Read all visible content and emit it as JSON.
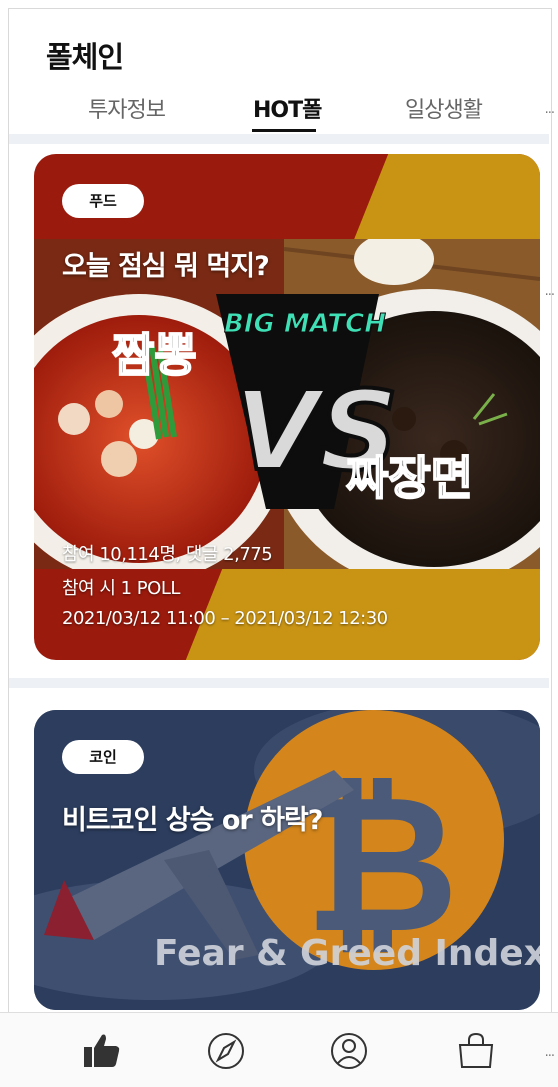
{
  "app": {
    "title": "폴체인"
  },
  "tabs": [
    {
      "label": "투자정보"
    },
    {
      "label": "HOT폴"
    },
    {
      "label": "일상생활"
    }
  ],
  "active_tab": "HOT폴",
  "more_label": "...",
  "polls": [
    {
      "category": "푸드",
      "title": "오늘 점심 뭐 먹지?",
      "image_text": {
        "left": "짬뽕",
        "right": "짜장면",
        "vs": "VS",
        "banner": "BIG MATCH"
      },
      "stats": "참여 10,114명, 댓글 2,775",
      "reward": "참여 시 1 POLL",
      "period": "2021/03/12 11:00 – 2021/03/12 12:30"
    },
    {
      "category": "코인",
      "title": "비트코인 상승 or 하락?",
      "image_text": {
        "overlay": "Fear & Greed Index"
      }
    }
  ],
  "bottom_nav": [
    {
      "icon": "thumbs-up-icon"
    },
    {
      "icon": "compass-icon"
    },
    {
      "icon": "user-icon"
    },
    {
      "icon": "shopping-bag-icon"
    }
  ],
  "colors": {
    "food_red": "#9a1a0d",
    "food_gold": "#c99414",
    "coin_navy": "#2c3d5e",
    "bitcoin_orange": "#d4861c",
    "vs_mint": "#3fe0b5"
  }
}
